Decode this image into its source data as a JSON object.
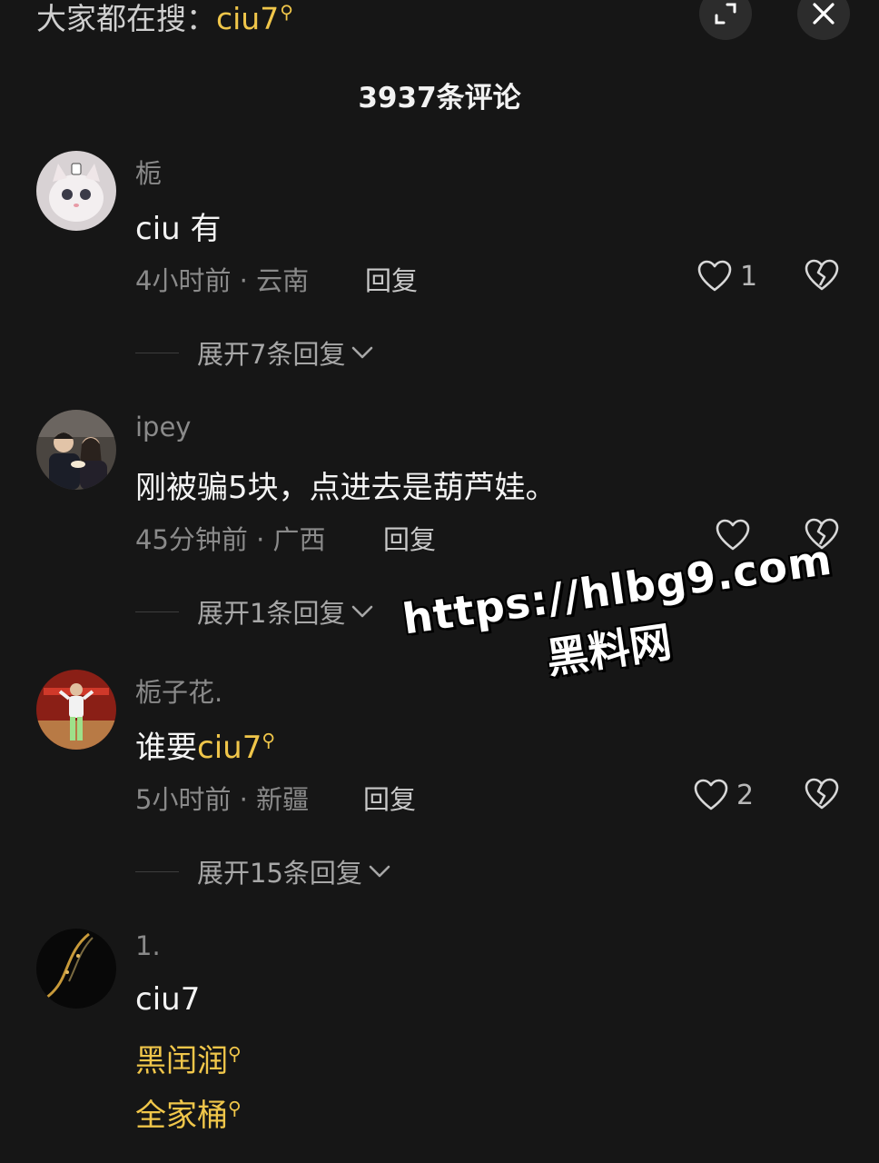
{
  "header": {
    "search_prefix": "大家都在搜：",
    "search_keyword": "ciu7",
    "comment_count": "3937条评论",
    "expand_icon": "expand-icon",
    "close_icon": "close-icon"
  },
  "comments": [
    {
      "username": "栀",
      "text": "ciu 有",
      "meta": "4小时前 · 云南",
      "reply_label": "回复",
      "likes": "1",
      "expand_label": "展开7条回复"
    },
    {
      "username": "ipey",
      "text": "刚被骗5块，点进去是葫芦娃。",
      "meta": "45分钟前 · 广西",
      "reply_label": "回复",
      "likes": "",
      "expand_label": "展开1条回复"
    },
    {
      "username": "栀子花.",
      "text_prefix": "谁要",
      "text_keyword": "ciu7",
      "meta": "5小时前 · 新疆",
      "reply_label": "回复",
      "likes": "2",
      "expand_label": "展开15条回复"
    },
    {
      "username": "1.",
      "text": "ciu7",
      "keywords": [
        "黑闰润",
        "全家桶"
      ]
    }
  ],
  "watermark": {
    "url": "https://hlbg9.com",
    "name": "黑料网"
  },
  "colors": {
    "background": "#161616",
    "keyword": "#f0c64a",
    "muted": "#8a8a8a"
  }
}
